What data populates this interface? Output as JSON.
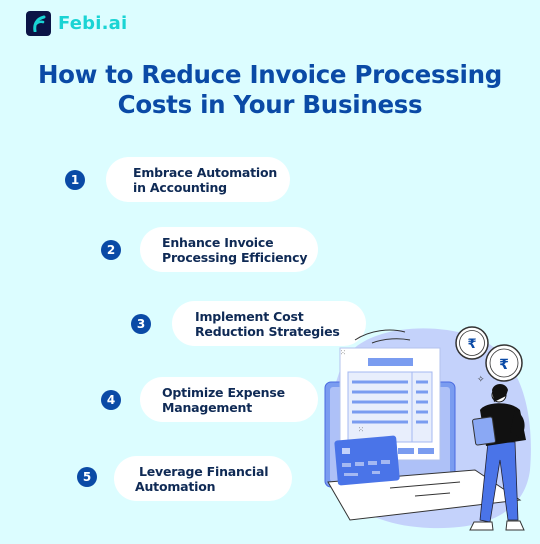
{
  "brand": {
    "name": "Febi.ai",
    "logo_icon": "febi-f-logo-icon",
    "accent_color": "#1ad4d4",
    "logo_bg_color": "#0b1446"
  },
  "title": {
    "line1": "How to Reduce Invoice Processing",
    "line2": "Costs in Your Business",
    "color": "#0a4aa6"
  },
  "steps": [
    {
      "number": "1",
      "line1": "Embrace Automation",
      "line2": "in Accounting"
    },
    {
      "number": "2",
      "line1": "Enhance Invoice",
      "line2": "Processing Efficiency"
    },
    {
      "number": "3",
      "line1": "Implement Cost",
      "line2": "Reduction Strategies"
    },
    {
      "number": "4",
      "line1": "Optimize Expense",
      "line2": "Management"
    },
    {
      "number": "5",
      "line1": "Leverage Financial",
      "line2": "Automation"
    }
  ],
  "illustration": {
    "description": "Person holding tablet next to laptop with invoice document, credit card and rupee coins",
    "coin_symbol": "₹",
    "icons": [
      "laptop-icon",
      "invoice-document-icon",
      "credit-card-icon",
      "rupee-coin-icon",
      "person-icon",
      "tablet-icon"
    ]
  },
  "background_color": "#dcfdff"
}
